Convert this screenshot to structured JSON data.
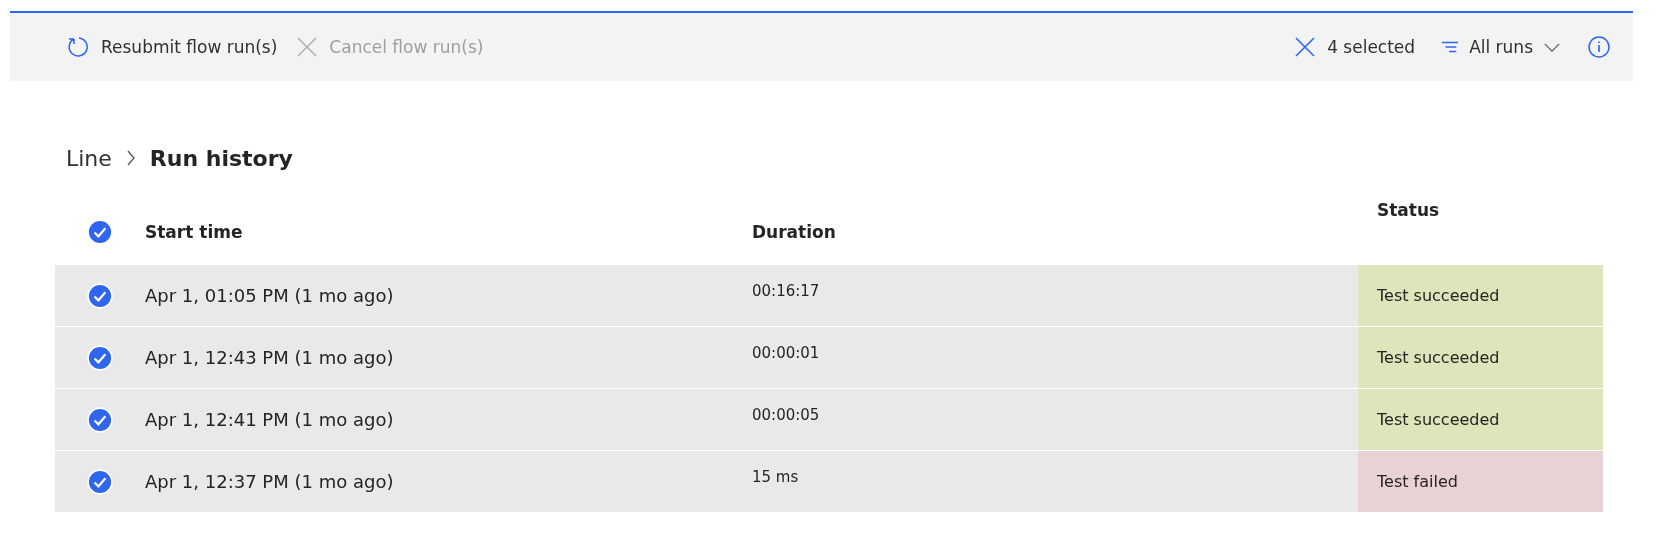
{
  "toolbar": {
    "actions": [
      {
        "label": "Resubmit flow run(s)",
        "kind": "resubmit",
        "disabled": false
      },
      {
        "label": "Cancel flow run(s)",
        "kind": "cancel",
        "disabled": true
      }
    ],
    "selection": {
      "label": "4 selected"
    },
    "filter": {
      "label": "All runs"
    }
  },
  "breadcrumb": {
    "parent": "Line",
    "current": "Run history"
  },
  "table": {
    "select_all": {
      "checked": true
    },
    "columns": [
      "Start time",
      "Duration",
      "Status"
    ],
    "rows": [
      {
        "selected": true,
        "start_time": "Apr 1, 01:05 PM (1 mo ago)",
        "duration": "00:16:17",
        "status": "Test succeeded",
        "kind": "succeeded"
      },
      {
        "selected": true,
        "start_time": "Apr 1, 12:43 PM (1 mo ago)",
        "duration": "00:00:01",
        "status": "Test succeeded",
        "kind": "succeeded"
      },
      {
        "selected": true,
        "start_time": "Apr 1, 12:41 PM (1 mo ago)",
        "duration": "00:00:05",
        "status": "Test succeeded",
        "kind": "succeeded"
      },
      {
        "selected": true,
        "start_time": "Apr 1, 12:37 PM (1 mo ago)",
        "duration": "15 ms",
        "status": "Test failed",
        "kind": "failed"
      }
    ]
  }
}
